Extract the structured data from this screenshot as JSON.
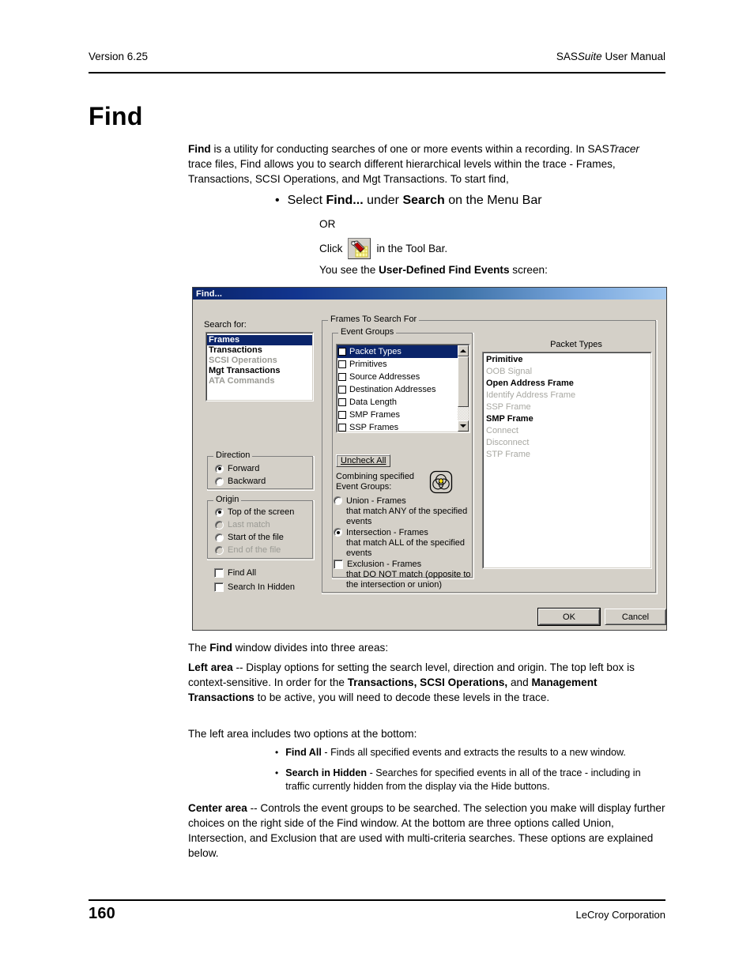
{
  "header": {
    "version": "Version 6.25",
    "manual_prefix": "SAS",
    "manual_italic": "Suite",
    "manual_suffix": " User Manual"
  },
  "footer": {
    "page_number": "160",
    "company": "LeCroy Corporation"
  },
  "page": {
    "title": "Find",
    "intro": {
      "lead": "Find",
      "text_1": " is a utility for conducting searches of one or more events within a recording. In SAS",
      "italic_1": "Tracer",
      "text_2": " trace files, Find allows you to search different hierarchical levels within the trace - Frames, Transactions, SCSI Operations, and Mgt Transactions.  To start find,"
    },
    "bullet_select": {
      "pre": "Select ",
      "bold_1": "Find...",
      "mid": " under ",
      "bold_2": "Search",
      "post": " on the Menu Bar"
    },
    "or_label": "OR",
    "click_pre": "Click",
    "click_post": "in the Tool Bar.",
    "you_see_pre": "You see the ",
    "you_see_bold": "User-Defined Find Events",
    "you_see_post": " screen:",
    "para_three_areas_pre": "The ",
    "para_three_areas_bold": "Find",
    "para_three_areas_post": " window divides into three areas:",
    "left_area": {
      "bold_lead": "Left area",
      "text_1": " --  Display options for setting the search level, direction and origin.   The top left box is context-sensitive. In order for the ",
      "bold_2": "Transactions, SCSI Operations,",
      "text_2": " and ",
      "bold_3": "Management Transactions",
      "text_3": " to be active, you will need to decode these levels in the trace."
    },
    "two_options_line": "The left area includes two options at the bottom:",
    "sub_bullets": [
      {
        "bold": "Find All",
        "text": " - Finds all specified events and extracts the results to a new window."
      },
      {
        "bold": "Search in Hidden",
        "text": " - Searches for specified events in all of the trace - including in traffic currently hidden from the display via the Hide buttons."
      }
    ],
    "center_area": {
      "bold_lead": "Center area",
      "text": "  -- Controls the event groups to be searched. The selection you make will display further choices on the right side of the Find window. At the bottom are three options called Union, Intersection, and Exclusion that are used with multi-criteria searches. These options are explained below."
    }
  },
  "dialog": {
    "title": "Find...",
    "search_for_label": "Search for:",
    "search_for_items": [
      {
        "label": "Frames",
        "state": "selected"
      },
      {
        "label": "Transactions",
        "state": "enabled"
      },
      {
        "label": "SCSI Operations",
        "state": "disabled"
      },
      {
        "label": "Mgt Transactions",
        "state": "enabled"
      },
      {
        "label": "ATA Commands",
        "state": "disabled"
      }
    ],
    "direction": {
      "caption": "Direction",
      "options": [
        {
          "label": "Forward",
          "checked": true,
          "enabled": true
        },
        {
          "label": "Backward",
          "checked": false,
          "enabled": true
        }
      ]
    },
    "origin": {
      "caption": "Origin",
      "options": [
        {
          "label": "Top of the screen",
          "checked": true,
          "enabled": true
        },
        {
          "label": "Last match",
          "checked": false,
          "enabled": false
        },
        {
          "label": "Start of the file",
          "checked": false,
          "enabled": true
        },
        {
          "label": "End of the file",
          "checked": false,
          "enabled": false
        }
      ]
    },
    "checkboxes": [
      {
        "label": "Find All",
        "checked": false
      },
      {
        "label": "Search In Hidden",
        "checked": false
      }
    ],
    "frames_group_caption": "Frames To Search For",
    "event_groups": {
      "caption": "Event Groups",
      "items": [
        {
          "label": "Packet Types",
          "checked": false,
          "selected": true
        },
        {
          "label": "Primitives",
          "checked": false,
          "selected": false
        },
        {
          "label": "Source Addresses",
          "checked": false,
          "selected": false
        },
        {
          "label": "Destination Addresses",
          "checked": false,
          "selected": false
        },
        {
          "label": "Data Length",
          "checked": false,
          "selected": false
        },
        {
          "label": "SMP Frames",
          "checked": false,
          "selected": false
        },
        {
          "label": "SSP Frames",
          "checked": false,
          "selected": false
        }
      ]
    },
    "uncheck_all_label": "Uncheck All",
    "combining_label": "Combining specified Event Groups:",
    "combine_options": [
      {
        "control": "radio",
        "checked": false,
        "label": "Union - Frames",
        "continuation": "that match ANY of the specified events"
      },
      {
        "control": "radio",
        "checked": true,
        "label": "Intersection - Frames",
        "continuation": "that match ALL of the specified events"
      },
      {
        "control": "checkbox",
        "checked": false,
        "label": "Exclusion - Frames",
        "continuation": "that DO NOT match (opposite to the intersection or union)"
      }
    ],
    "packet_types_title": "Packet Types",
    "packet_types_items": [
      {
        "label": "Primitive",
        "enabled": true
      },
      {
        "label": "OOB Signal",
        "enabled": false
      },
      {
        "label": "Open Address Frame",
        "enabled": true
      },
      {
        "label": "Identify Address Frame",
        "enabled": false
      },
      {
        "label": "SSP Frame",
        "enabled": false
      },
      {
        "label": "SMP Frame",
        "enabled": true
      },
      {
        "label": "Connect",
        "enabled": false
      },
      {
        "label": "Disconnect",
        "enabled": false
      },
      {
        "label": "STP Frame",
        "enabled": false
      }
    ],
    "ok_label": "OK",
    "cancel_label": "Cancel"
  },
  "colors": {
    "titlebar_start": "#0a246a",
    "titlebar_end": "#a6caf0",
    "dialog_face": "#d4d0c8",
    "selection": "#0a246a",
    "disabled_text": "#9a9a94",
    "venn_center": "#ffe000"
  }
}
